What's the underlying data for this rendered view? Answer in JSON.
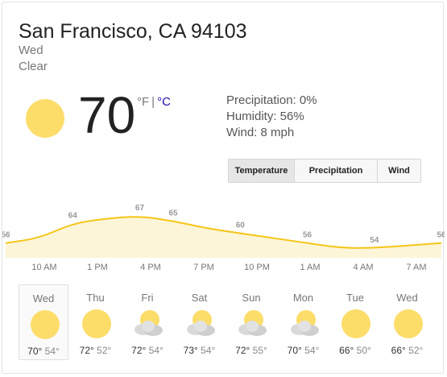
{
  "location": "San Francisco, CA 94103",
  "day": "Wed",
  "condition": "Clear",
  "current": {
    "temperature": "70",
    "unit_f": "°F",
    "unit_sep": "|",
    "unit_c": "°C",
    "icon": "sun-icon"
  },
  "details": {
    "precipitation": "Precipitation: 0%",
    "humidity": "Humidity: 56%",
    "wind": "Wind: 8 mph"
  },
  "tabs": [
    {
      "label": "Temperature",
      "active": true
    },
    {
      "label": "Precipitation",
      "active": false
    },
    {
      "label": "Wind",
      "active": false
    }
  ],
  "colors": {
    "accent_line": "#f5c518",
    "fill": "#fdf5d7",
    "sun": "#fddd6a",
    "cloud": "#d9d9d9"
  },
  "chart_data": {
    "type": "area",
    "values": [
      56,
      58,
      64,
      66,
      67,
      65,
      62,
      60,
      58,
      56,
      54,
      54,
      55,
      56
    ],
    "value_labels": [
      "56",
      "64",
      "67",
      "65",
      "60",
      "56",
      "54",
      "56"
    ],
    "label_indices": [
      0,
      2,
      4,
      5,
      7,
      9,
      11,
      13
    ],
    "ylim": [
      50,
      72
    ],
    "time_labels": [
      "10 AM",
      "1 PM",
      "4 PM",
      "7 PM",
      "10 PM",
      "1 AM",
      "4 AM",
      "7 AM"
    ]
  },
  "forecast": [
    {
      "day": "Wed",
      "icon": "sun-icon",
      "hi": "70°",
      "lo": "54°"
    },
    {
      "day": "Thu",
      "icon": "sun-icon",
      "hi": "72°",
      "lo": "52°"
    },
    {
      "day": "Fri",
      "icon": "partly-cloudy-icon",
      "hi": "72°",
      "lo": "54°"
    },
    {
      "day": "Sat",
      "icon": "partly-cloudy-icon",
      "hi": "73°",
      "lo": "54°"
    },
    {
      "day": "Sun",
      "icon": "partly-cloudy-icon",
      "hi": "72°",
      "lo": "55°"
    },
    {
      "day": "Mon",
      "icon": "partly-cloudy-icon",
      "hi": "70°",
      "lo": "54°"
    },
    {
      "day": "Tue",
      "icon": "sun-icon",
      "hi": "66°",
      "lo": "50°"
    },
    {
      "day": "Wed",
      "icon": "sun-icon",
      "hi": "66°",
      "lo": "52°"
    }
  ]
}
